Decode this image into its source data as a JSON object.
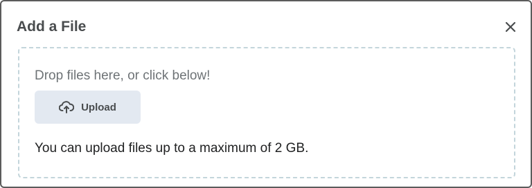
{
  "dialog": {
    "title": "Add a File",
    "close_icon": "close-icon"
  },
  "dropzone": {
    "prompt": "Drop files here, or click below!",
    "upload_label": "Upload",
    "upload_icon": "cloud-upload-icon",
    "limit_text": "You can upload files up to a maximum of 2 GB."
  }
}
